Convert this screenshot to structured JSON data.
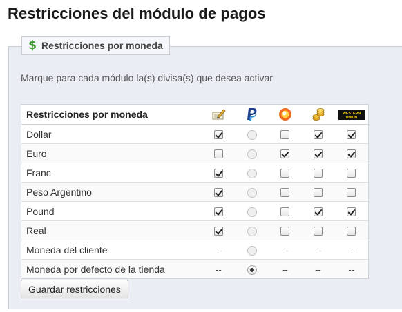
{
  "page": {
    "title": "Restricciones del módulo de pagos"
  },
  "section": {
    "legend": "Restricciones por moneda",
    "legend_icon": "dollar-icon",
    "description": "Marque para cada módulo la(s) divisa(s) que desea activar"
  },
  "table": {
    "header_label": "Restricciones por moneda",
    "modules": [
      {
        "icon": "cheque-pencil-icon"
      },
      {
        "icon": "paypal-icon"
      },
      {
        "icon": "moneybookers-icon"
      },
      {
        "icon": "coins-icon"
      },
      {
        "icon": "western-union-icon",
        "icon_text": "WESTERN UNION"
      }
    ],
    "rows": [
      {
        "label": "Dollar",
        "cells": [
          "on",
          "radio",
          "off",
          "on",
          "on"
        ]
      },
      {
        "label": "Euro",
        "cells": [
          "off_on_fix",
          "radio",
          "on",
          "on",
          "on"
        ]
      },
      {
        "label": "Franc",
        "cells": [
          "on",
          "radio",
          "off",
          "off",
          "off"
        ]
      },
      {
        "label": "Peso Argentino",
        "cells": [
          "on",
          "radio",
          "off",
          "off",
          "off"
        ]
      },
      {
        "label": "Pound",
        "cells": [
          "on",
          "radio",
          "off",
          "on",
          "on"
        ]
      },
      {
        "label": "Real",
        "cells": [
          "on",
          "radio",
          "off",
          "off",
          "off"
        ]
      },
      {
        "label": "Moneda del cliente",
        "cells": [
          "--",
          "radio",
          "--",
          "--",
          "--"
        ]
      },
      {
        "label": "Moneda por defecto de la tienda",
        "cells": [
          "--",
          "radio_on",
          "--",
          "--",
          "--"
        ]
      }
    ],
    "dash_text": "--"
  },
  "actions": {
    "save_label": "Guardar restricciones"
  }
}
